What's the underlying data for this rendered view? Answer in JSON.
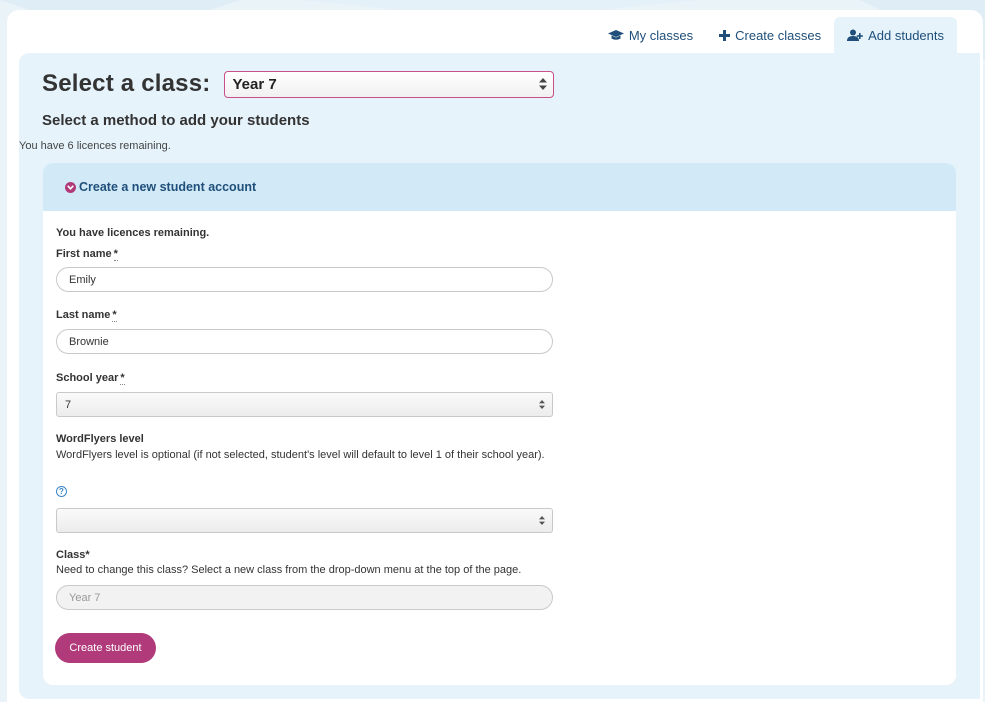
{
  "tabs": [
    {
      "label": "My classes",
      "icon": "graduation-cap-icon"
    },
    {
      "label": "Create classes",
      "icon": "plus-icon"
    },
    {
      "label": "Add students",
      "icon": "add-user-icon"
    }
  ],
  "header": {
    "select_title": "Select a class:",
    "selected_class": "Year 7"
  },
  "method_title": "Select a method to add your students",
  "licences_note": "You have 6 licences remaining.",
  "accordion": {
    "title": "Create a new student account",
    "icon": "chevron-down-circle-icon"
  },
  "form": {
    "licences_text": "You have licences remaining.",
    "first_name_label": "First name",
    "first_name_value": "Emily",
    "last_name_label": "Last name",
    "last_name_value": "Brownie",
    "school_year_label": "School year",
    "school_year_value": "7",
    "level_label": "WordFlyers level",
    "level_help": "WordFlyers level is optional (if not selected, student's level will default to level 1 of their school year).",
    "level_value": "",
    "class_label": "Class",
    "class_help": "Need to change this class? Select a new class from the drop-down menu at the top of the page.",
    "class_value": "Year 7",
    "required_mark": "*",
    "help_icon_glyph": "?",
    "submit_label": "Create student"
  },
  "colors": {
    "accent": "#b13b7a",
    "panel_bg": "#e6f3fb",
    "header_bg": "#d2eaf7",
    "link": "#1f4f7a"
  }
}
